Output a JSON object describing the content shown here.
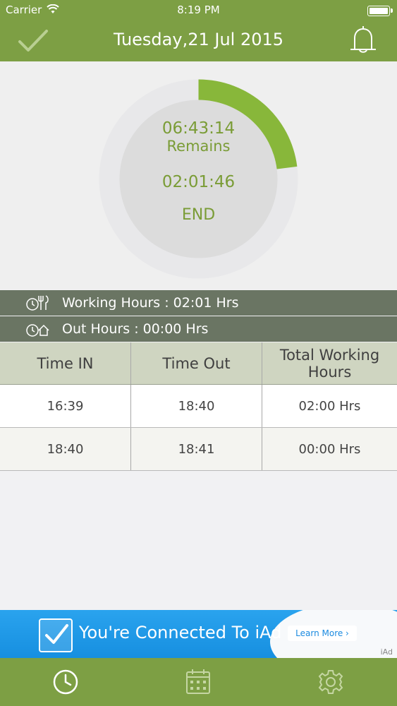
{
  "status": {
    "carrier": "Carrier",
    "time": "8:19 PM"
  },
  "header": {
    "title": "Tuesday,21 Jul 2015"
  },
  "timer": {
    "remaining_time": "06:43:14",
    "remaining_label": "Remains",
    "elapsed_time": "02:01:46",
    "action_label": "END",
    "progress_fraction": 0.23
  },
  "summary": {
    "working_hours": "Working Hours : 02:01 Hrs",
    "out_hours": "Out Hours : 00:00 Hrs"
  },
  "table": {
    "headers": [
      "Time IN",
      "Time Out",
      "Total Working Hours"
    ],
    "rows": [
      [
        "16:39",
        "18:40",
        "02:00 Hrs"
      ],
      [
        "18:40",
        "18:41",
        "00:00 Hrs"
      ]
    ]
  },
  "ad": {
    "text": "You're Connected To iAd",
    "button": "Learn More ›",
    "tag": "iAd"
  },
  "tabs": [
    {
      "icon": "clock-icon"
    },
    {
      "icon": "calendar-icon"
    },
    {
      "icon": "gear-icon"
    }
  ],
  "colors": {
    "brand": "#7d9f44",
    "accent": "#86b33b",
    "bar": "#6a7563",
    "table_header": "#cfd5c1"
  }
}
